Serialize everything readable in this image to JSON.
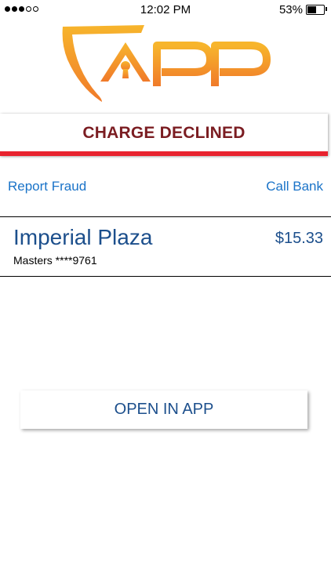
{
  "status_bar": {
    "signal_dots": [
      "filled",
      "filled",
      "filled",
      "empty",
      "empty"
    ],
    "time": "12:02 PM",
    "battery_percent_label": "53%",
    "battery_level": 0.53
  },
  "logo": {
    "text": "APP",
    "icon": "shield-keyhole-icon",
    "colors": [
      "#f7b52c",
      "#f07a2a"
    ]
  },
  "alert": {
    "title": "CHARGE DECLINED",
    "accent_color": "#e8232e",
    "title_color": "#7b1d22"
  },
  "actions": {
    "report_fraud": "Report Fraud",
    "call_bank": "Call Bank"
  },
  "transaction": {
    "merchant": "Imperial Plaza",
    "amount": "$15.33",
    "card": "Masters ****9761"
  },
  "open_button": {
    "label": "OPEN IN APP"
  },
  "colors": {
    "link": "#1a73c8",
    "primary_text": "#1c4f8c"
  }
}
